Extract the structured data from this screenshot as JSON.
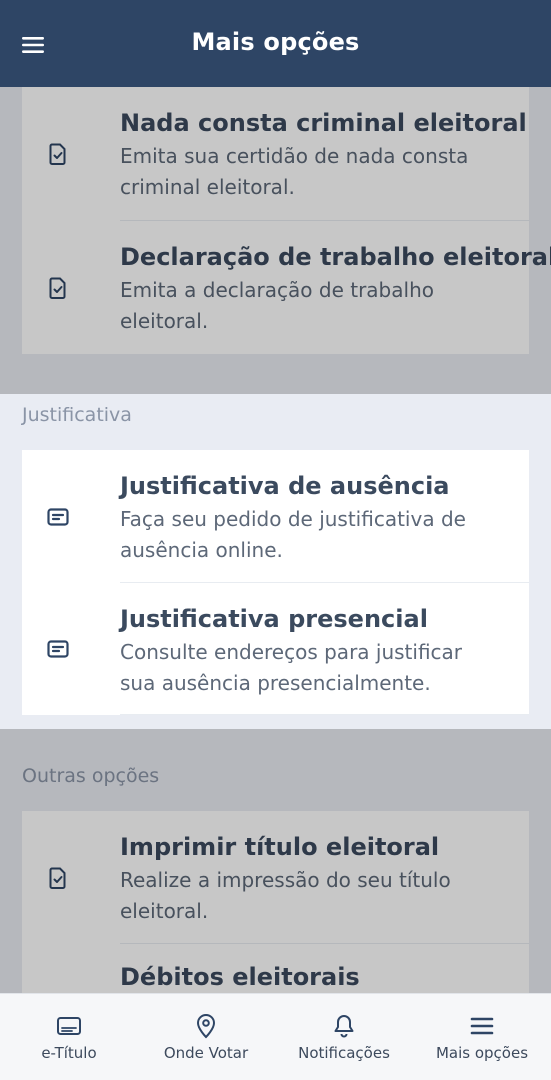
{
  "header": {
    "title": "Mais opções",
    "menu_icon": "hamburger-menu-icon"
  },
  "top_items": [
    {
      "title": "Nada consta criminal eleitoral",
      "desc_line1": "Emita sua certidão de nada consta",
      "desc_line2": "criminal eleitoral.",
      "icon": "document-check-icon"
    },
    {
      "title": "Declaração de trabalho eleitoral",
      "desc_line1": "Emita a declaração de trabalho",
      "desc_line2": "eleitoral.",
      "icon": "document-check-icon"
    }
  ],
  "justificativa": {
    "label": "Justificativa",
    "items": [
      {
        "title": "Justificativa de ausência",
        "desc_line1": "Faça seu pedido de justificativa de",
        "desc_line2": "ausência online.",
        "icon": "message-lines-icon"
      },
      {
        "title": "Justificativa presencial",
        "desc_line1": "Consulte endereços para justificar",
        "desc_line2": "sua ausência presencialmente.",
        "icon": "message-lines-icon"
      }
    ]
  },
  "outras": {
    "label": "Outras opções",
    "items": [
      {
        "title": "Imprimir título eleitoral",
        "desc_line1": "Realize a impressão do seu título",
        "desc_line2": "eleitoral.",
        "icon": "document-check-icon"
      },
      {
        "title": "Débitos eleitorais"
      }
    ]
  },
  "bottom_nav": [
    {
      "label": "e-Título",
      "icon": "id-card-icon"
    },
    {
      "label": "Onde Votar",
      "icon": "location-pin-icon"
    },
    {
      "label": "Notificações",
      "icon": "bell-icon"
    },
    {
      "label": "Mais opções",
      "icon": "hamburger-menu-icon"
    }
  ],
  "colors": {
    "header": "#2e4565",
    "accent": "#2e4565",
    "background": "#e9ecf3"
  }
}
